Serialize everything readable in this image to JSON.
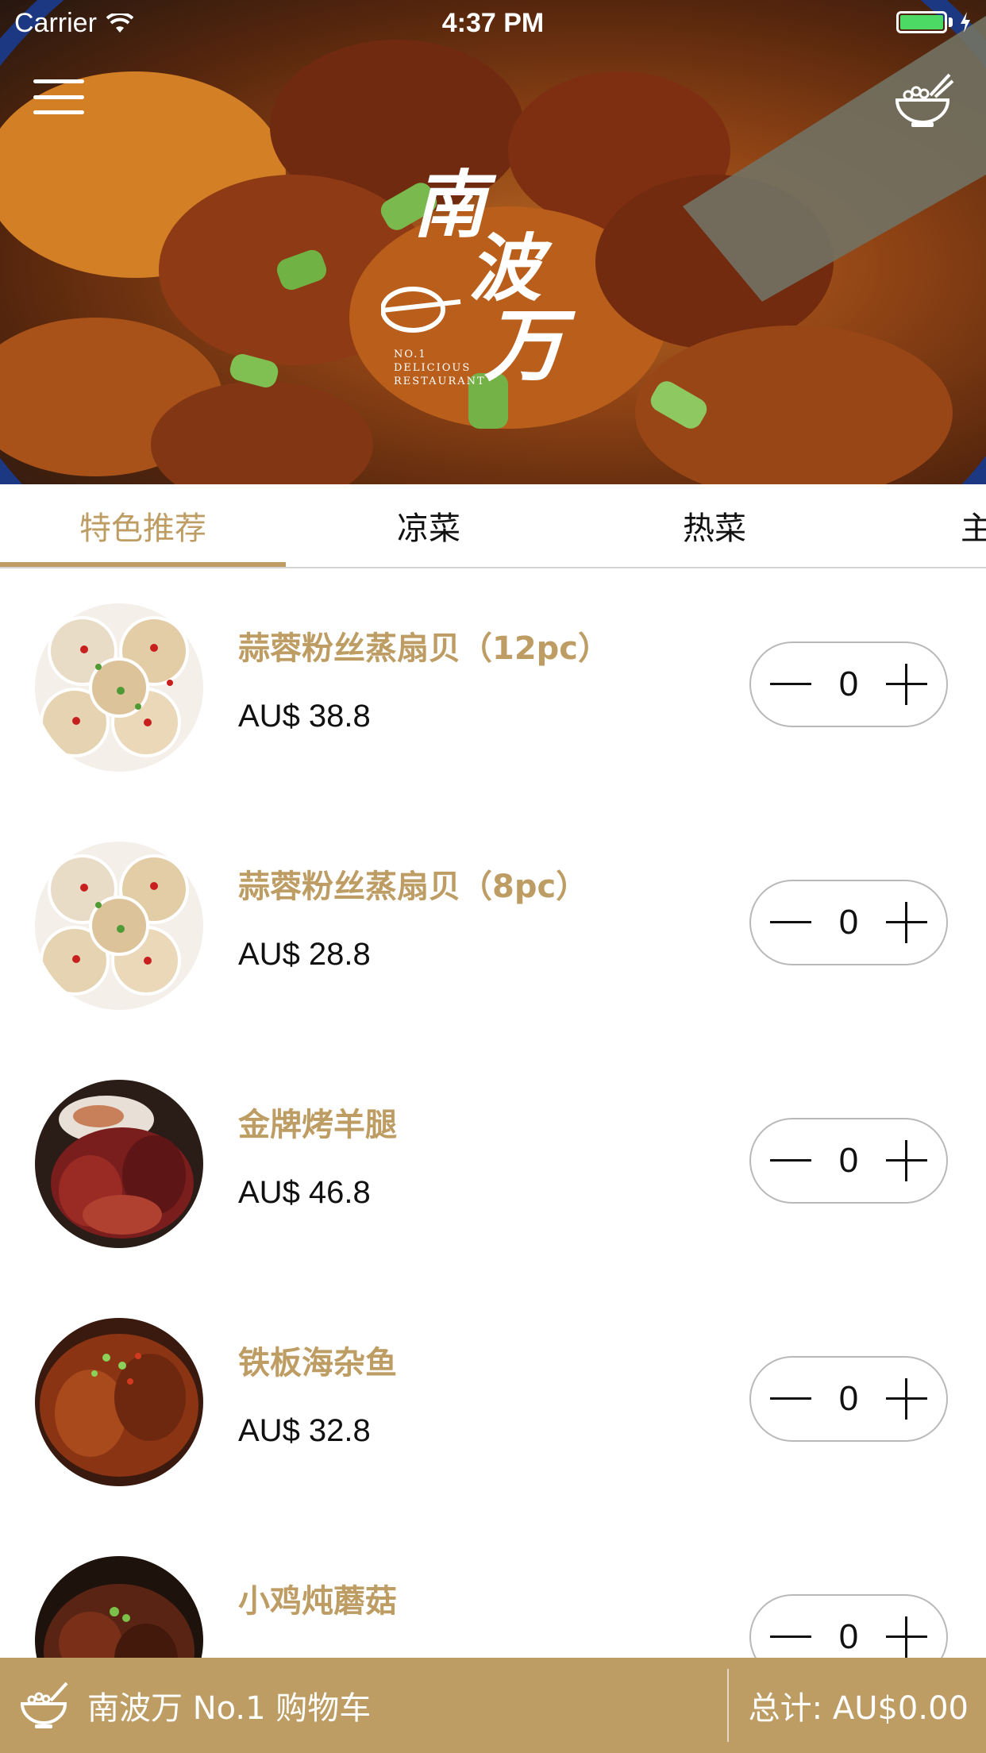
{
  "status_bar": {
    "carrier": "Carrier",
    "time": "4:37 PM"
  },
  "header": {
    "logo_text": "南波万",
    "logo_sub": [
      "NO.1",
      "DELICIOUS",
      "RESTAURANT"
    ]
  },
  "tabs": [
    {
      "label": "特色推荐",
      "active": true
    },
    {
      "label": "凉菜",
      "active": false
    },
    {
      "label": "热菜",
      "active": false
    },
    {
      "label": "主",
      "active": false
    }
  ],
  "menu_items": [
    {
      "name": "蒜蓉粉丝蒸扇贝（12pc）",
      "price": "AU$ 38.8",
      "qty": "0",
      "photo": "scallops"
    },
    {
      "name": "蒜蓉粉丝蒸扇贝（8pc）",
      "price": "AU$ 28.8",
      "qty": "0",
      "photo": "scallops"
    },
    {
      "name": "金牌烤羊腿",
      "price": "AU$ 46.8",
      "qty": "0",
      "photo": "lamb"
    },
    {
      "name": "铁板海杂鱼",
      "price": "AU$ 32.8",
      "qty": "0",
      "photo": "fish"
    },
    {
      "name": "小鸡炖蘑菇",
      "price": "",
      "qty": "0",
      "photo": "chicken"
    }
  ],
  "cart": {
    "label": "南波万 No.1 购物车",
    "total": "总计: AU$0.00"
  },
  "colors": {
    "accent": "#bd9d63",
    "text": "#111111",
    "battery": "#4cd964"
  }
}
